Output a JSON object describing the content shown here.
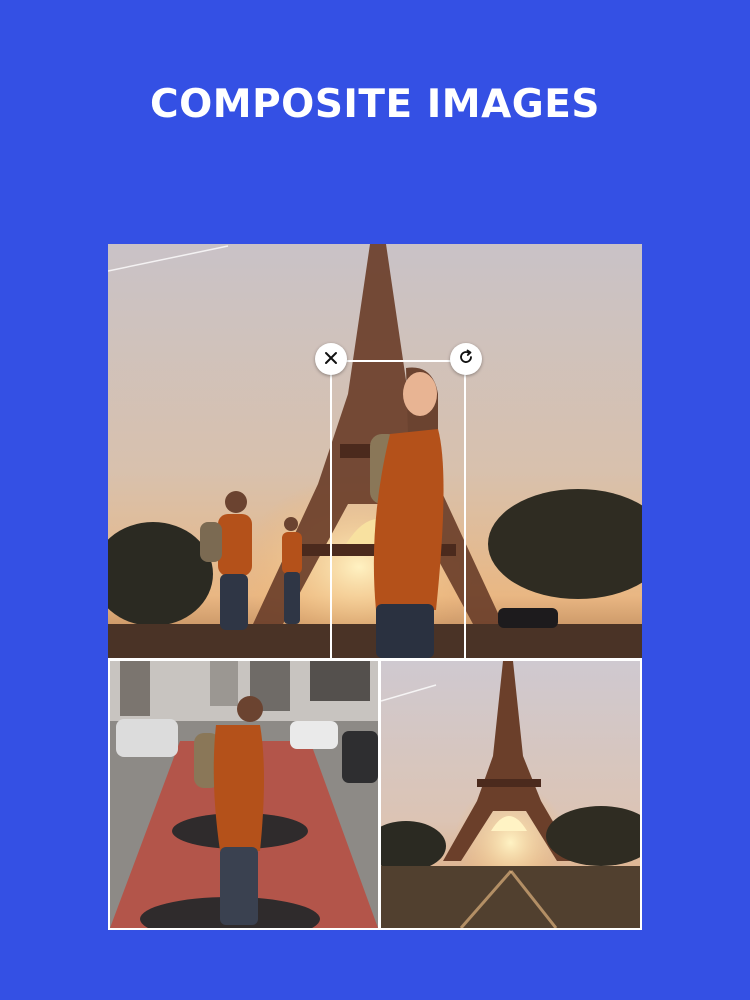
{
  "title": "COMPOSITE IMAGES",
  "colors": {
    "background": "#3450e4",
    "title_text": "#ffffff",
    "frame": "#ffffff"
  },
  "photos": {
    "main": "eiffel-tower-sunset-with-woman-cutouts",
    "bottom_left": "woman-on-city-bike-lane",
    "bottom_right": "eiffel-tower-sunset"
  },
  "icons": {
    "close": "close-icon",
    "rotate": "rotate-icon"
  }
}
